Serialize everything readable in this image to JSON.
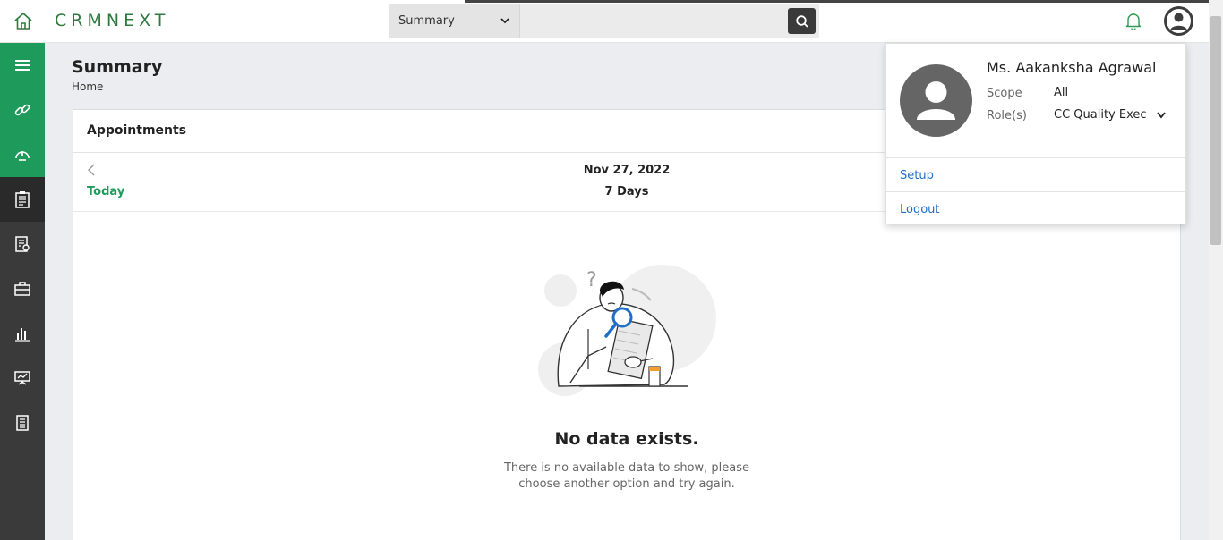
{
  "header": {
    "brand": "CRMNEXT",
    "search_scope": "Summary",
    "search_value": ""
  },
  "page": {
    "title": "Summary",
    "breadcrumb": "Home"
  },
  "appointments": {
    "title": "Appointments",
    "date": "Nov 27, 2022",
    "today_label": "Today",
    "range_label": "7 Days",
    "empty_title": "No data exists.",
    "empty_desc": "There is no available data to show, please choose another option and try again."
  },
  "profile": {
    "name": "Ms. Aakanksha Agrawal",
    "scope_label": "Scope",
    "scope_value": "All",
    "role_label": "Role(s)",
    "role_value": "CC Quality Executive",
    "menu": [
      {
        "label": "Setup"
      },
      {
        "label": "Logout"
      }
    ]
  },
  "sidebar": {
    "items": [
      {
        "icon": "menu-icon"
      },
      {
        "icon": "link-icon"
      },
      {
        "icon": "dashboard-icon"
      },
      {
        "icon": "clipboard-icon"
      },
      {
        "icon": "report-icon"
      },
      {
        "icon": "briefcase-icon"
      },
      {
        "icon": "bar-chart-icon"
      },
      {
        "icon": "presentation-icon"
      },
      {
        "icon": "ledger-icon"
      }
    ]
  },
  "colors": {
    "brand_green": "#1e9b5a",
    "sidebar_dark": "#3a3a3a",
    "link_blue": "#1f6fc9"
  }
}
